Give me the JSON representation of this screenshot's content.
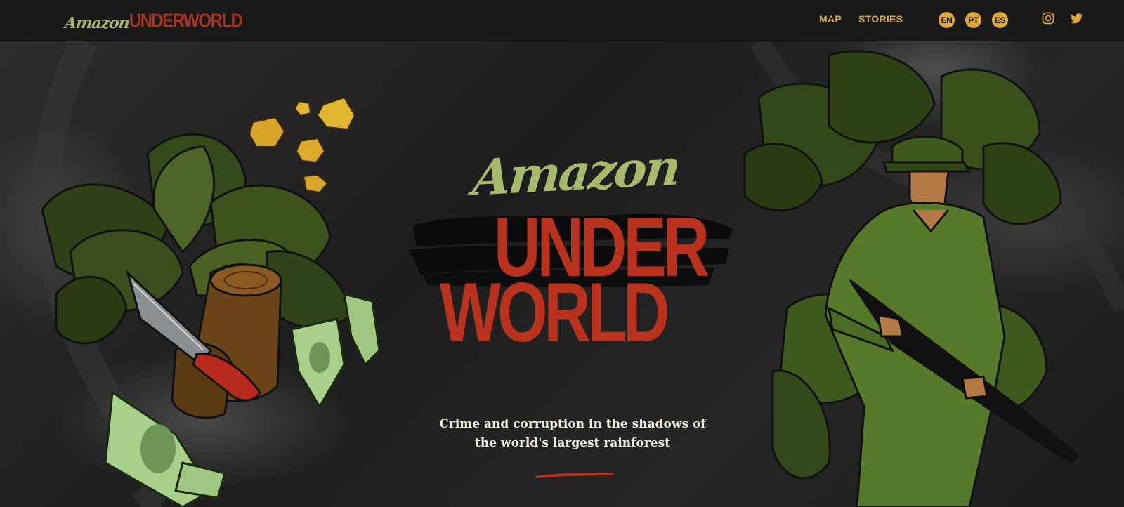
{
  "nav": {
    "logo": {
      "amazon": "Amazon",
      "underworld": "UNDERWORLD"
    },
    "links": [
      {
        "label": "MAP"
      },
      {
        "label": "STORIES"
      }
    ],
    "languages": [
      {
        "code": "EN"
      },
      {
        "code": "PT"
      },
      {
        "code": "ES"
      }
    ],
    "social": [
      {
        "icon": "instagram-icon"
      },
      {
        "icon": "twitter-icon"
      }
    ]
  },
  "hero": {
    "title_amazon": "Amazon",
    "title_under": "UNDER",
    "title_world": "WORLD",
    "tagline_line1": "Crime and corruption in the shadows of",
    "tagline_line2": "the world's largest rainforest"
  },
  "colors": {
    "accent_orange": "#e0a63a",
    "title_green": "#a9b96a",
    "title_red": "#b8321e",
    "background": "#181818"
  }
}
